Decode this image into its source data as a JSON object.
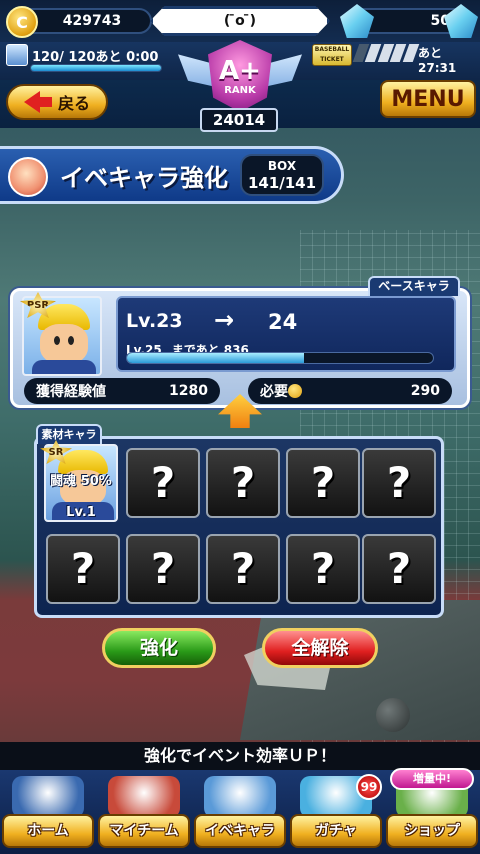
{
  "top": {
    "coins": "429743",
    "face": "( ̄o ̄)",
    "gems": "50",
    "stamina": "120/ 120あと 0:00",
    "stamina_ratio": 1.0,
    "ticket_label": "BASEBALL TICKET",
    "timer": "あと27:31"
  },
  "header": {
    "back_label": "戻る",
    "menu_label": "MENU",
    "rank_letter": "A+",
    "rank_word": "RANK",
    "rank_score": "24014"
  },
  "title": {
    "text": "イベキャラ強化",
    "box_label": "BOX",
    "box_value": "141/141"
  },
  "base": {
    "tab_label": "ベースキャラ",
    "rarity": "PSR",
    "lv_from": "Lv.23",
    "lv_arrow": "→",
    "lv_to": "24",
    "next_lv": "Lv.25",
    "next_text": "まであと 836",
    "exp_ratio": 0.58,
    "exp_label": "獲得経験値",
    "exp_value": "1280",
    "req_label": "必要",
    "req_value": "290"
  },
  "material": {
    "tab_label": "素材キャラ",
    "rarity": "SR",
    "bonus": "闘魂 50%",
    "lv": "Lv.1",
    "slot_glyph": "?"
  },
  "actions": {
    "enhance_label": "強化",
    "clear_label": "全解除"
  },
  "tip": "強化でイベント効率ＵＰ！",
  "nav": {
    "items": [
      {
        "label": "ホーム",
        "icon": "book-icon",
        "color": "#3a6ab0"
      },
      {
        "label": "マイチーム",
        "icon": "team-icon",
        "color": "#c84a3a"
      },
      {
        "label": "イベキャラ",
        "icon": "character-icon",
        "color": "#5a9ad8"
      },
      {
        "label": "ガチャ",
        "icon": "gacha-icon",
        "color": "#4ab0e0"
      },
      {
        "label": "ショップ",
        "icon": "shop-icon",
        "color": "#6ab04a"
      }
    ],
    "gacha_badge": "99",
    "shop_sale": "増量中!"
  },
  "colors": {
    "panel_blue": "#10275c",
    "button_gold": "#f0b020",
    "enhance_green": "#2a9a18",
    "clear_red": "#e02020"
  }
}
